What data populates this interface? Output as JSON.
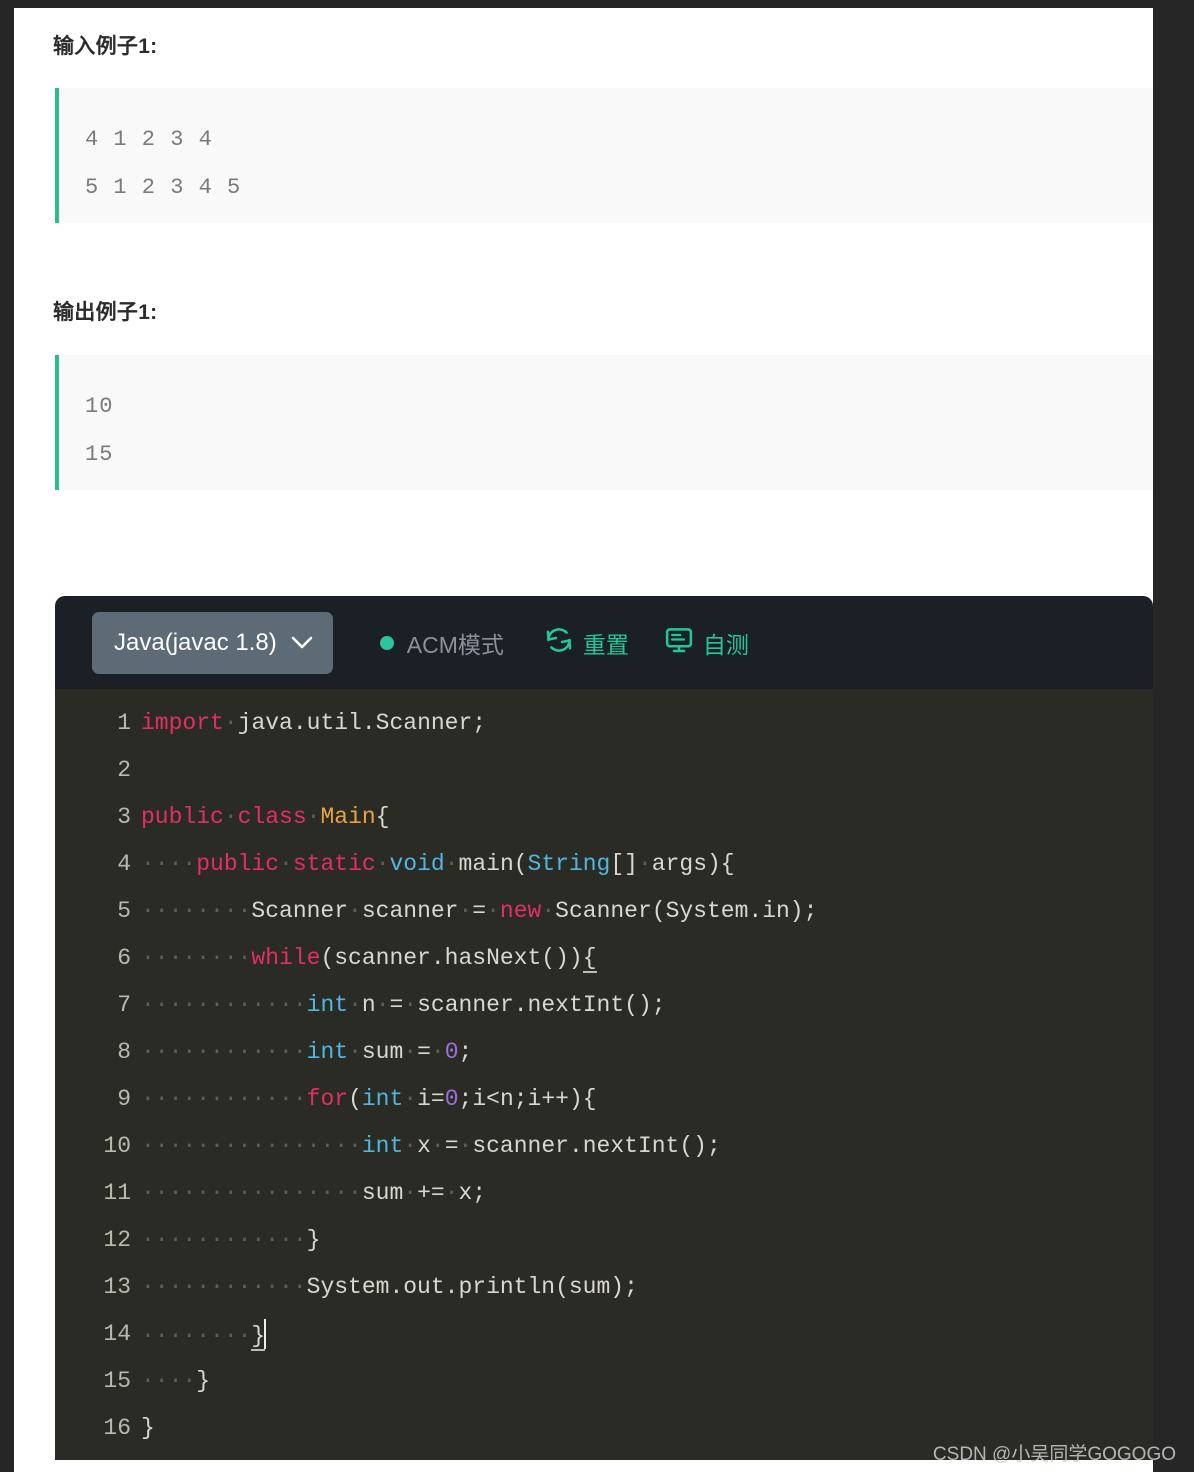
{
  "sections": [
    {
      "heading": "输入例子1:",
      "lines": [
        "4 1 2 3 4",
        "5 1 2 3 4 5"
      ]
    },
    {
      "heading": "输出例子1:",
      "lines": [
        "10",
        "15"
      ]
    }
  ],
  "editor": {
    "language_label": "Java(javac 1.8)",
    "chevron_icon": "chevron-down-icon",
    "mode_label": "ACM模式",
    "mode_dot_color": "#2ec4a0",
    "reset_label": "重置",
    "reset_icon": "refresh-icon",
    "selftest_label": "自测",
    "selftest_icon": "monitor-icon",
    "accent_color": "#20c997",
    "toolbar_bg": "#1b2026",
    "code_bg": "#2b2b26",
    "line_numbers": [
      "1",
      "2",
      "3",
      "4",
      "5",
      "6",
      "7",
      "8",
      "9",
      "10",
      "11",
      "12",
      "13",
      "14",
      "15",
      "16"
    ],
    "code_lines": [
      "import java.util.Scanner;",
      "",
      "public class Main{",
      "    public static void main(String[] args){",
      "        Scanner scanner = new Scanner(System.in);",
      "        while(scanner.hasNext()){",
      "            int n = scanner.nextInt();",
      "            int sum = 0;",
      "            for(int i=0;i<n;i++){",
      "                int x = scanner.nextInt();",
      "                sum += x;",
      "            }",
      "            System.out.println(sum);",
      "        }",
      "    }",
      "}"
    ]
  },
  "watermark": "CSDN @小吴同学GOGOGO",
  "theme": {
    "page_bg": "#ffffff",
    "outer_bg": "#262626",
    "sample_bg": "#f9f9f9",
    "sample_accent": "#26c08f",
    "sample_text": "#7a7a7a"
  }
}
